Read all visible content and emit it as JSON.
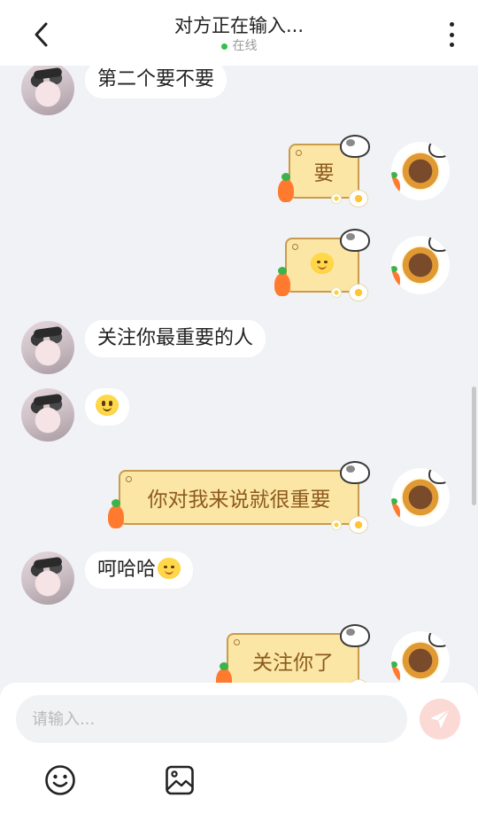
{
  "header": {
    "title": "对方正在输入...",
    "status": "在线",
    "status_color": "#2fc14a"
  },
  "messages": [
    {
      "side": "left",
      "text": "第二个要不要"
    },
    {
      "side": "right",
      "text": "要"
    },
    {
      "side": "right",
      "emoji": "smiling-face"
    },
    {
      "side": "left",
      "text": "关注你最重要的人"
    },
    {
      "side": "left",
      "emoji": "grinning-face"
    },
    {
      "side": "right",
      "text": "你对我来说就很重要"
    },
    {
      "side": "left",
      "text": "呵哈哈",
      "emoji": "blushing-smile-face"
    },
    {
      "side": "right",
      "text": "关注你了"
    }
  ],
  "input": {
    "placeholder": "请输入..."
  },
  "icons": {
    "back": "chevron-left-icon",
    "more": "more-vertical-icon",
    "send": "paper-plane-icon",
    "emoji": "emoji-smile-icon",
    "image": "image-icon"
  },
  "colors": {
    "right_bubble_bg": "#fce6a6",
    "right_bubble_text": "#8b5a1d",
    "left_bubble_bg": "#ffffff",
    "chat_bg": "#f0f2f5",
    "send_bg": "#fbd9d5"
  }
}
